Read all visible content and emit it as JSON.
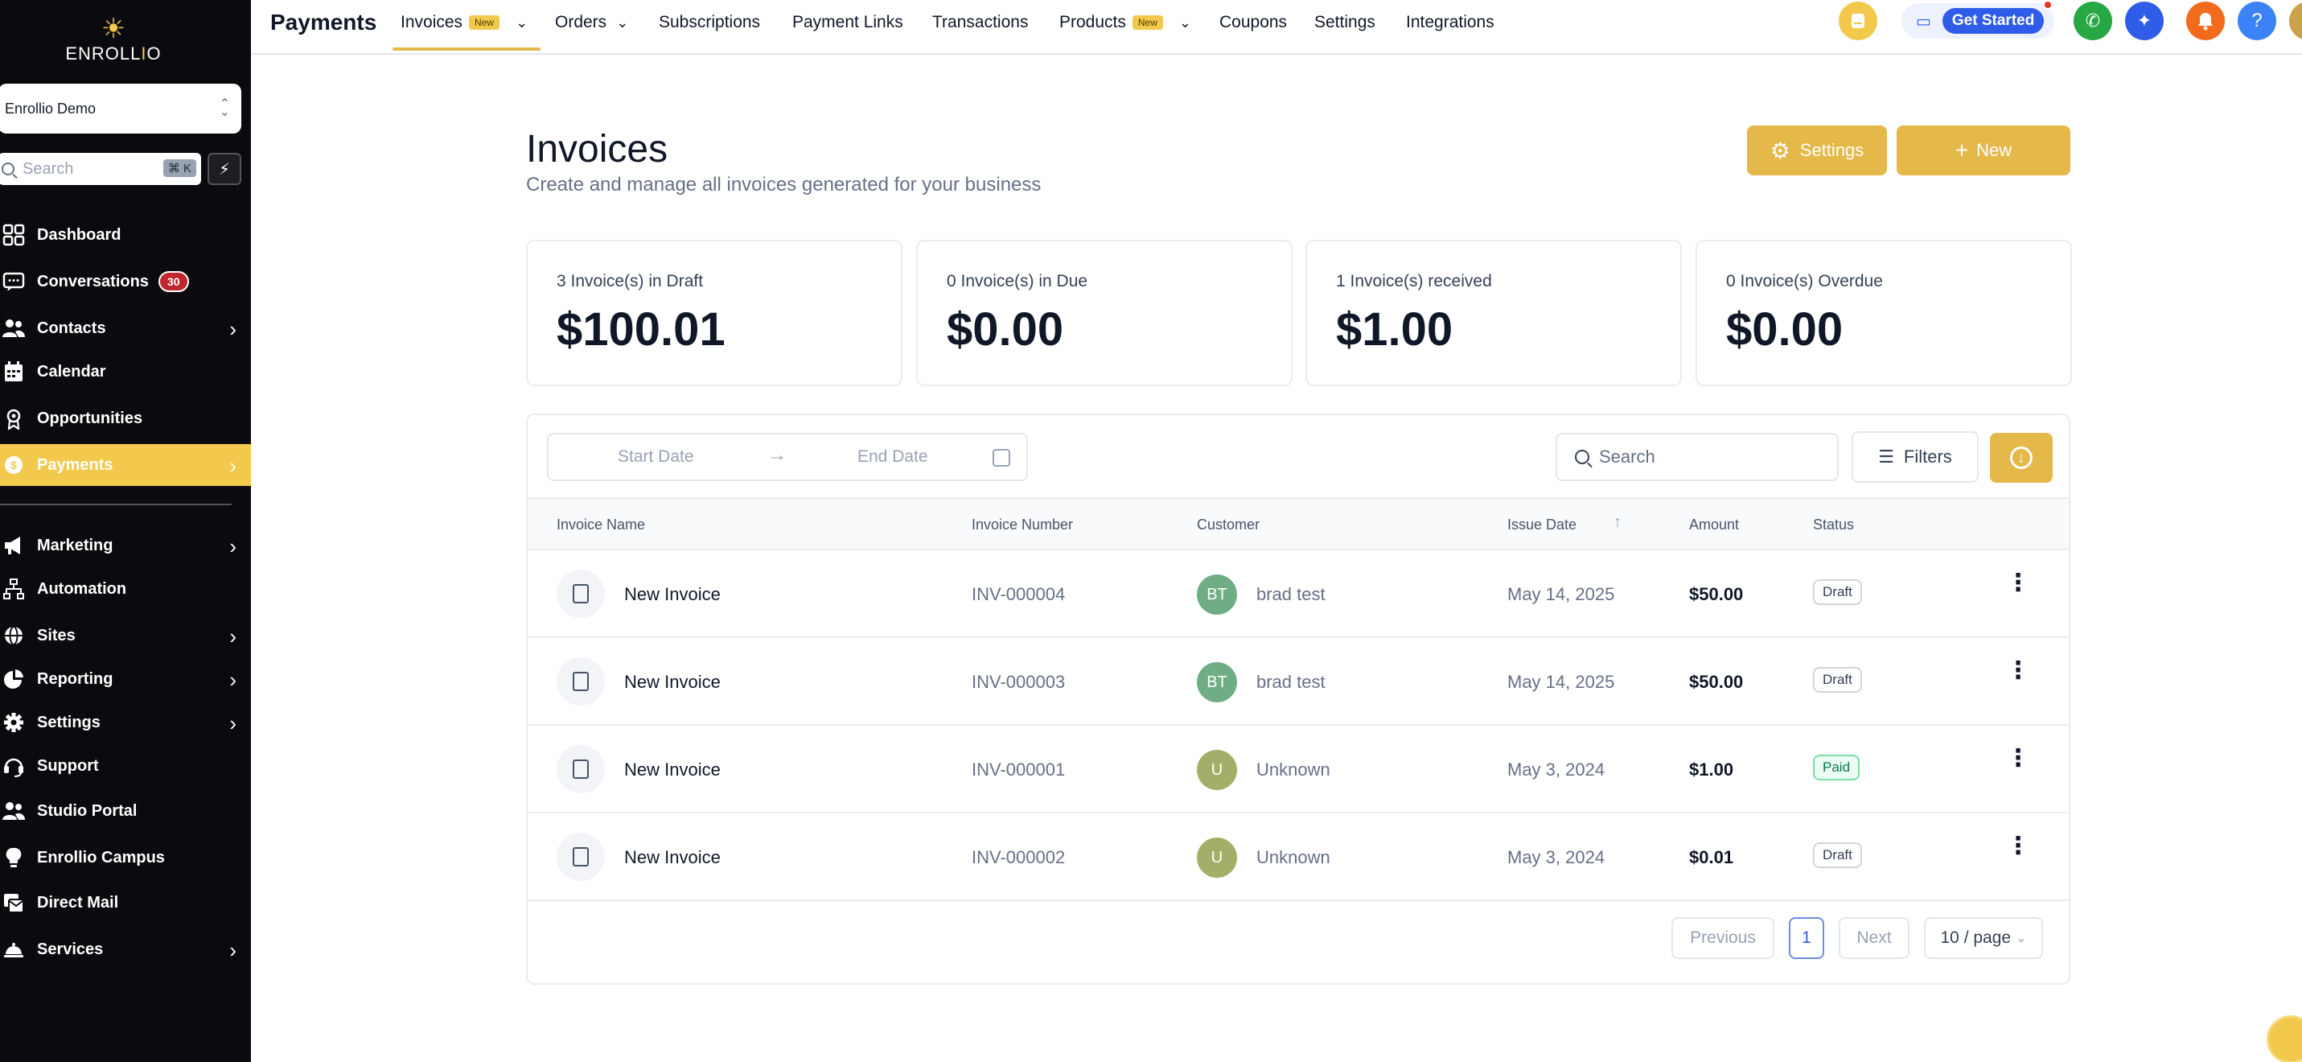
{
  "sidebar": {
    "logo": {
      "brand_pre": "ENROLL",
      "brand_mid": "I",
      "brand_post": "O",
      "icon": "sun-icon"
    },
    "account": "Enrollio Demo",
    "search": {
      "placeholder": "Search",
      "shortcut": "⌘ K"
    },
    "items": [
      {
        "label": "Dashboard",
        "icon": "dashboard-icon"
      },
      {
        "label": "Conversations",
        "icon": "chat-icon",
        "badge": "30"
      },
      {
        "label": "Contacts",
        "icon": "contacts-icon"
      },
      {
        "label": "Calendar",
        "icon": "calendar-icon"
      },
      {
        "label": "Opportunities",
        "icon": "opportunities-icon"
      },
      {
        "label": "Payments",
        "icon": "payments-icon"
      },
      {
        "label": "Marketing",
        "icon": "megaphone-icon"
      },
      {
        "label": "Automation",
        "icon": "automation-icon"
      },
      {
        "label": "Sites",
        "icon": "globe-icon"
      },
      {
        "label": "Reporting",
        "icon": "pie-chart-icon"
      },
      {
        "label": "Settings",
        "icon": "gear-icon"
      },
      {
        "label": "Support",
        "icon": "headset-icon"
      },
      {
        "label": "Studio Portal",
        "icon": "users-icon"
      },
      {
        "label": "Enrollio Campus",
        "icon": "lightbulb-icon"
      },
      {
        "label": "Direct Mail",
        "icon": "mail-icon"
      },
      {
        "label": "Services",
        "icon": "bell-service-icon"
      }
    ]
  },
  "topbar": {
    "title": "Payments",
    "tabs": [
      {
        "label": "Invoices",
        "tag": "New"
      },
      {
        "label": "Orders"
      },
      {
        "label": "Subscriptions"
      },
      {
        "label": "Payment Links"
      },
      {
        "label": "Transactions"
      },
      {
        "label": "Products",
        "tag": "New"
      },
      {
        "label": "Coupons"
      },
      {
        "label": "Settings"
      },
      {
        "label": "Integrations"
      }
    ],
    "get_started": "Get Started"
  },
  "page": {
    "title": "Invoices",
    "subtitle": "Create and manage all invoices generated for your business",
    "settings_button": "Settings",
    "new_button": "New"
  },
  "cards": [
    {
      "label": "3 Invoice(s) in Draft",
      "value": "$100.01"
    },
    {
      "label": "0 Invoice(s) in Due",
      "value": "$0.00"
    },
    {
      "label": "1 Invoice(s) received",
      "value": "$1.00"
    },
    {
      "label": "0 Invoice(s) Overdue",
      "value": "$0.00"
    }
  ],
  "filters": {
    "start_placeholder": "Start Date",
    "end_placeholder": "End Date",
    "search_placeholder": "Search",
    "filters_label": "Filters"
  },
  "table": {
    "columns": [
      "Invoice Name",
      "Invoice Number",
      "Customer",
      "Issue Date",
      "Amount",
      "Status"
    ],
    "rows": [
      {
        "name": "New Invoice",
        "number": "INV-000004",
        "initials": "BT",
        "customer": "brad test",
        "date": "May 14, 2025",
        "amount": "$50.00",
        "status": "Draft",
        "avatar_color": "#6fae85"
      },
      {
        "name": "New Invoice",
        "number": "INV-000003",
        "initials": "BT",
        "customer": "brad test",
        "date": "May 14, 2025",
        "amount": "$50.00",
        "status": "Draft",
        "avatar_color": "#6fae85"
      },
      {
        "name": "New Invoice",
        "number": "INV-000001",
        "initials": "U",
        "customer": "Unknown",
        "date": "May 3, 2024",
        "amount": "$1.00",
        "status": "Paid",
        "avatar_color": "#a3ae68"
      },
      {
        "name": "New Invoice",
        "number": "INV-000002",
        "initials": "U",
        "customer": "Unknown",
        "date": "May 3, 2024",
        "amount": "$0.01",
        "status": "Draft",
        "avatar_color": "#a3ae68"
      }
    ]
  },
  "pagination": {
    "previous": "Previous",
    "current": "1",
    "next": "Next",
    "per_page": "10 / page"
  },
  "colors": {
    "accent": "#e5b84a",
    "sidebar_active": "#f2c94c",
    "sidebar_bg": "#0b0b0f",
    "blue": "#2f5ce8"
  }
}
